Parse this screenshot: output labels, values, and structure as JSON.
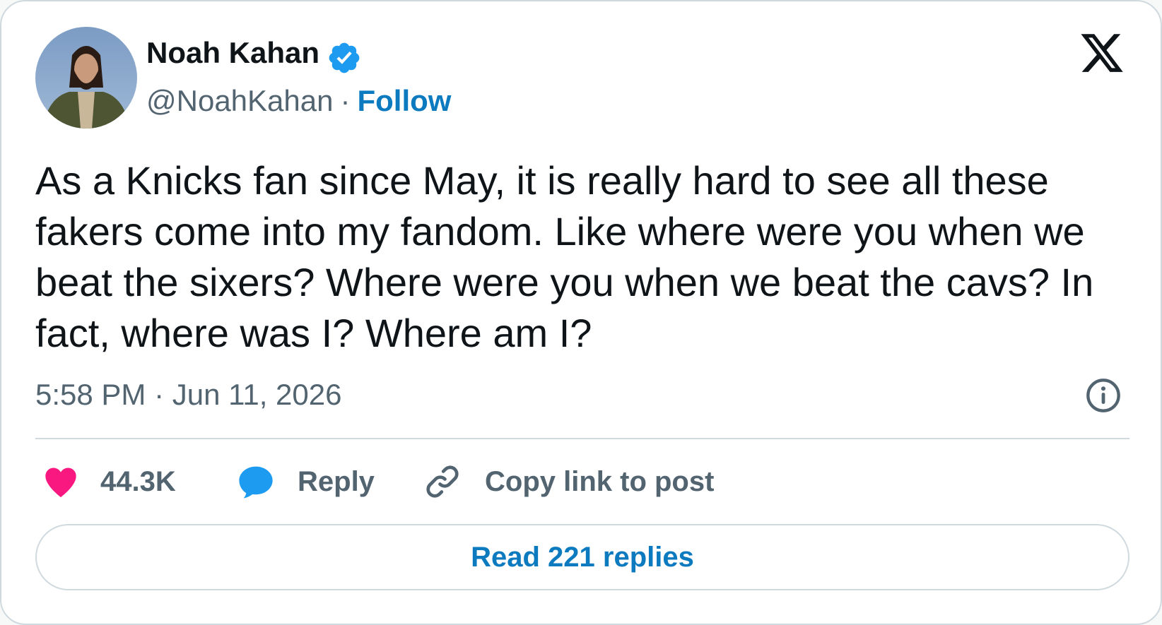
{
  "author": {
    "name": "Noah Kahan",
    "handle": "@NoahKahan",
    "separator": "·",
    "follow_label": "Follow",
    "verified": true
  },
  "tweet": {
    "text": "As a Knicks fan since May, it is really hard to see all these fakers come into my fandom. Like where were you when we beat the sixers? Where were you when we beat the cavs? In fact, where was I? Where am I?",
    "timestamp": "5:58 PM · Jun 11, 2026"
  },
  "actions": {
    "likes_count": "44.3K",
    "reply_label": "Reply",
    "copy_link_label": "Copy link to post"
  },
  "read_replies_label": "Read 221 replies",
  "colors": {
    "link_blue": "#0c7abf",
    "verified_blue": "#1d9bf0",
    "like_pink": "#f91880",
    "reply_blue": "#1d9bf0",
    "text_primary": "#0f1419",
    "text_secondary": "#536471",
    "border": "#cfd9de"
  },
  "icons": {
    "verified": "verified-badge-icon",
    "brand": "x-logo-icon",
    "info": "info-icon",
    "like": "heart-icon",
    "reply": "speech-bubble-icon",
    "copy": "link-icon"
  }
}
